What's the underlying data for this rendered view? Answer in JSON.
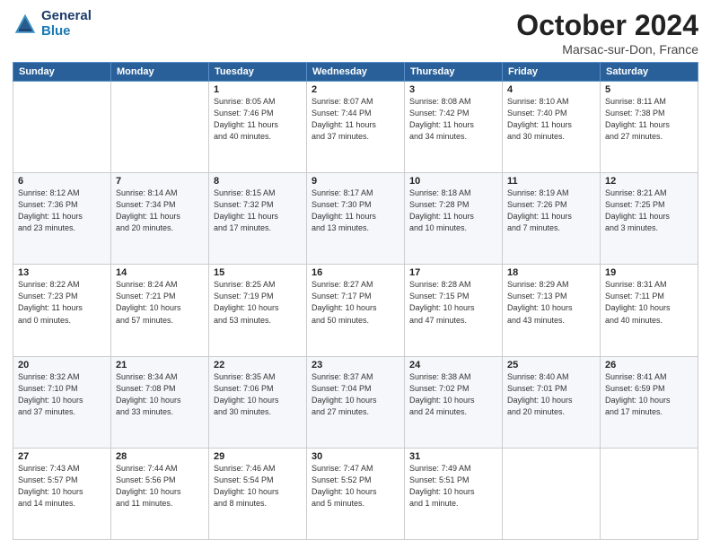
{
  "header": {
    "logo_line1": "General",
    "logo_line2": "Blue",
    "month": "October 2024",
    "location": "Marsac-sur-Don, France"
  },
  "days_of_week": [
    "Sunday",
    "Monday",
    "Tuesday",
    "Wednesday",
    "Thursday",
    "Friday",
    "Saturday"
  ],
  "weeks": [
    [
      {
        "day": "",
        "info": ""
      },
      {
        "day": "",
        "info": ""
      },
      {
        "day": "1",
        "info": "Sunrise: 8:05 AM\nSunset: 7:46 PM\nDaylight: 11 hours\nand 40 minutes."
      },
      {
        "day": "2",
        "info": "Sunrise: 8:07 AM\nSunset: 7:44 PM\nDaylight: 11 hours\nand 37 minutes."
      },
      {
        "day": "3",
        "info": "Sunrise: 8:08 AM\nSunset: 7:42 PM\nDaylight: 11 hours\nand 34 minutes."
      },
      {
        "day": "4",
        "info": "Sunrise: 8:10 AM\nSunset: 7:40 PM\nDaylight: 11 hours\nand 30 minutes."
      },
      {
        "day": "5",
        "info": "Sunrise: 8:11 AM\nSunset: 7:38 PM\nDaylight: 11 hours\nand 27 minutes."
      }
    ],
    [
      {
        "day": "6",
        "info": "Sunrise: 8:12 AM\nSunset: 7:36 PM\nDaylight: 11 hours\nand 23 minutes."
      },
      {
        "day": "7",
        "info": "Sunrise: 8:14 AM\nSunset: 7:34 PM\nDaylight: 11 hours\nand 20 minutes."
      },
      {
        "day": "8",
        "info": "Sunrise: 8:15 AM\nSunset: 7:32 PM\nDaylight: 11 hours\nand 17 minutes."
      },
      {
        "day": "9",
        "info": "Sunrise: 8:17 AM\nSunset: 7:30 PM\nDaylight: 11 hours\nand 13 minutes."
      },
      {
        "day": "10",
        "info": "Sunrise: 8:18 AM\nSunset: 7:28 PM\nDaylight: 11 hours\nand 10 minutes."
      },
      {
        "day": "11",
        "info": "Sunrise: 8:19 AM\nSunset: 7:26 PM\nDaylight: 11 hours\nand 7 minutes."
      },
      {
        "day": "12",
        "info": "Sunrise: 8:21 AM\nSunset: 7:25 PM\nDaylight: 11 hours\nand 3 minutes."
      }
    ],
    [
      {
        "day": "13",
        "info": "Sunrise: 8:22 AM\nSunset: 7:23 PM\nDaylight: 11 hours\nand 0 minutes."
      },
      {
        "day": "14",
        "info": "Sunrise: 8:24 AM\nSunset: 7:21 PM\nDaylight: 10 hours\nand 57 minutes."
      },
      {
        "day": "15",
        "info": "Sunrise: 8:25 AM\nSunset: 7:19 PM\nDaylight: 10 hours\nand 53 minutes."
      },
      {
        "day": "16",
        "info": "Sunrise: 8:27 AM\nSunset: 7:17 PM\nDaylight: 10 hours\nand 50 minutes."
      },
      {
        "day": "17",
        "info": "Sunrise: 8:28 AM\nSunset: 7:15 PM\nDaylight: 10 hours\nand 47 minutes."
      },
      {
        "day": "18",
        "info": "Sunrise: 8:29 AM\nSunset: 7:13 PM\nDaylight: 10 hours\nand 43 minutes."
      },
      {
        "day": "19",
        "info": "Sunrise: 8:31 AM\nSunset: 7:11 PM\nDaylight: 10 hours\nand 40 minutes."
      }
    ],
    [
      {
        "day": "20",
        "info": "Sunrise: 8:32 AM\nSunset: 7:10 PM\nDaylight: 10 hours\nand 37 minutes."
      },
      {
        "day": "21",
        "info": "Sunrise: 8:34 AM\nSunset: 7:08 PM\nDaylight: 10 hours\nand 33 minutes."
      },
      {
        "day": "22",
        "info": "Sunrise: 8:35 AM\nSunset: 7:06 PM\nDaylight: 10 hours\nand 30 minutes."
      },
      {
        "day": "23",
        "info": "Sunrise: 8:37 AM\nSunset: 7:04 PM\nDaylight: 10 hours\nand 27 minutes."
      },
      {
        "day": "24",
        "info": "Sunrise: 8:38 AM\nSunset: 7:02 PM\nDaylight: 10 hours\nand 24 minutes."
      },
      {
        "day": "25",
        "info": "Sunrise: 8:40 AM\nSunset: 7:01 PM\nDaylight: 10 hours\nand 20 minutes."
      },
      {
        "day": "26",
        "info": "Sunrise: 8:41 AM\nSunset: 6:59 PM\nDaylight: 10 hours\nand 17 minutes."
      }
    ],
    [
      {
        "day": "27",
        "info": "Sunrise: 7:43 AM\nSunset: 5:57 PM\nDaylight: 10 hours\nand 14 minutes."
      },
      {
        "day": "28",
        "info": "Sunrise: 7:44 AM\nSunset: 5:56 PM\nDaylight: 10 hours\nand 11 minutes."
      },
      {
        "day": "29",
        "info": "Sunrise: 7:46 AM\nSunset: 5:54 PM\nDaylight: 10 hours\nand 8 minutes."
      },
      {
        "day": "30",
        "info": "Sunrise: 7:47 AM\nSunset: 5:52 PM\nDaylight: 10 hours\nand 5 minutes."
      },
      {
        "day": "31",
        "info": "Sunrise: 7:49 AM\nSunset: 5:51 PM\nDaylight: 10 hours\nand 1 minute."
      },
      {
        "day": "",
        "info": ""
      },
      {
        "day": "",
        "info": ""
      }
    ]
  ]
}
